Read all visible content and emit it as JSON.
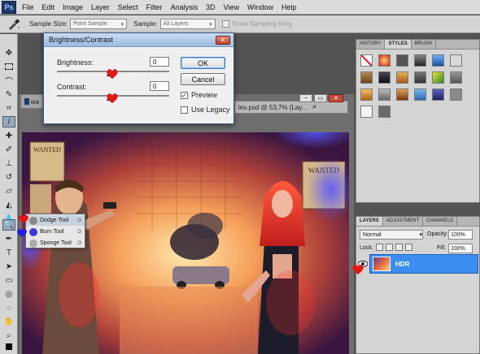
{
  "menu": {
    "logo": "Ps",
    "items": [
      "File",
      "Edit",
      "Image",
      "Layer",
      "Select",
      "Filter",
      "Analysis",
      "3D",
      "View",
      "Window",
      "Help"
    ]
  },
  "options": {
    "sample_size_label": "Sample Size:",
    "sample_size_value": "Point Sample",
    "sample_label": "Sample:",
    "sample_value": "All Layers",
    "show_ring_label": "Show Sampling Ring"
  },
  "dialog": {
    "title": "Brightness/Contrast",
    "brightness_label": "Brightness:",
    "brightness_value": "0",
    "contrast_label": "Contrast:",
    "contrast_value": "0",
    "ok_label": "OK",
    "cancel_label": "Cancel",
    "preview_label": "Preview",
    "legacy_label": "Use Legacy"
  },
  "doc_tabs": [
    {
      "label": "wa"
    },
    {
      "label": "les.psd @ 53,7% (Lay..."
    }
  ],
  "flyout": {
    "items": [
      {
        "label": "Dodge Tool",
        "key": "O"
      },
      {
        "label": "Burn Tool",
        "key": "O"
      },
      {
        "label": "Sponge Tool",
        "key": "O"
      }
    ]
  },
  "panel_top": {
    "tabs": [
      "HISTORY",
      "STYLES",
      "BRUSH"
    ]
  },
  "layers_panel": {
    "tabs": [
      "LAYERS",
      "ADJUSTMENT",
      "CHANNELS"
    ],
    "blend_mode": "Normal",
    "opacity_label": "Opacity:",
    "opacity_value": "100%",
    "lock_label": "Lock:",
    "fill_label": "Fill:",
    "fill_value": "100%",
    "layer_name": "HDR"
  },
  "artwork": {
    "poster_text": "WANTED"
  }
}
